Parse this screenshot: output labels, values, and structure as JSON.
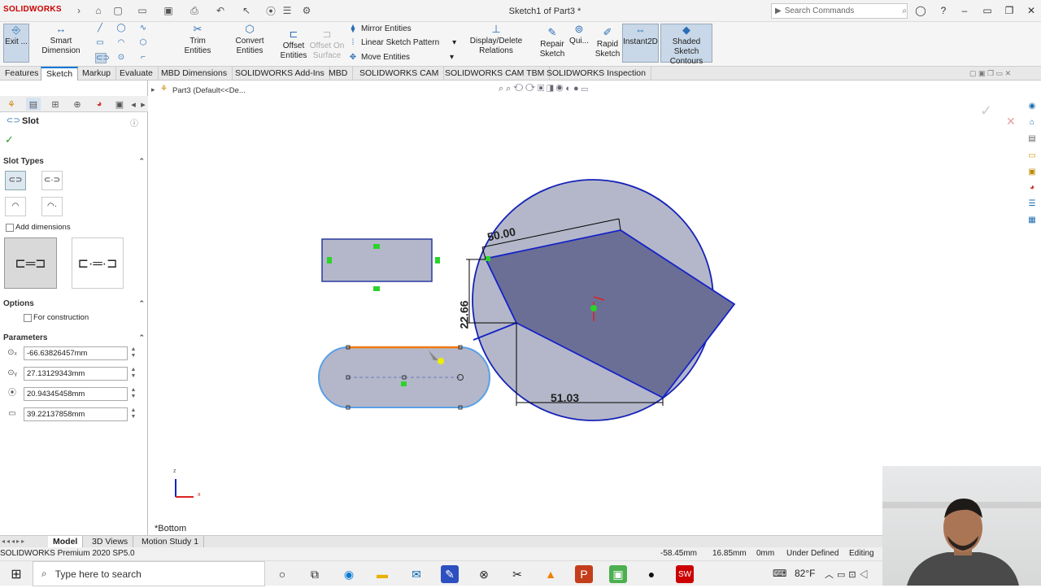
{
  "app": {
    "brand": "SOLIDWORKS",
    "title": "Sketch1 of Part3 *"
  },
  "search": {
    "placeholder": "Search Commands"
  },
  "ribbon": {
    "exit": "Exit ...",
    "smart_dimension": "Smart Dimension",
    "trim": "Trim Entities",
    "convert": "Convert Entities",
    "offset": "Offset Entities",
    "offset_surface": "Offset On Surface",
    "mirror": "Mirror Entities",
    "linear_pattern": "Linear Sketch Pattern",
    "move": "Move Entities",
    "display_delete": "Display/Delete Relations",
    "repair": "Repair Sketch",
    "quick": "Qui...",
    "rapid": "Rapid Sketch",
    "instant2d": "Instant2D",
    "shaded": "Shaded Sketch Contours"
  },
  "tabs": [
    "Features",
    "Sketch",
    "Markup",
    "Evaluate",
    "MBD Dimensions",
    "SOLIDWORKS Add-Ins",
    "MBD",
    "SOLIDWORKS CAM",
    "SOLIDWORKS CAM TBM",
    "SOLIDWORKS Inspection"
  ],
  "tree": {
    "root": "Part3  (Default<<De..."
  },
  "panel": {
    "title": "Slot",
    "slot_types": "Slot Types",
    "add_dimensions": "Add dimensions",
    "options": "Options",
    "for_construction": "For construction",
    "parameters": "Parameters",
    "params": [
      "-66.63826457mm",
      "27.13129343mm",
      "20.94345458mm",
      "39.22137858mm"
    ]
  },
  "sketch": {
    "dim1": "50.00",
    "dim2": "22.66",
    "dim3": "51.03",
    "view": "*Bottom"
  },
  "bottom_tabs": [
    "Model",
    "3D Views",
    "Motion Study 1"
  ],
  "status": {
    "product": "SOLIDWORKS Premium 2020 SP5.0",
    "x": "-58.45mm",
    "y": "16.85mm",
    "z": "0mm",
    "state": "Under Defined",
    "mode": "Editing Sk"
  },
  "taskbar": {
    "search": "Type here to search",
    "temp": "82°F"
  }
}
